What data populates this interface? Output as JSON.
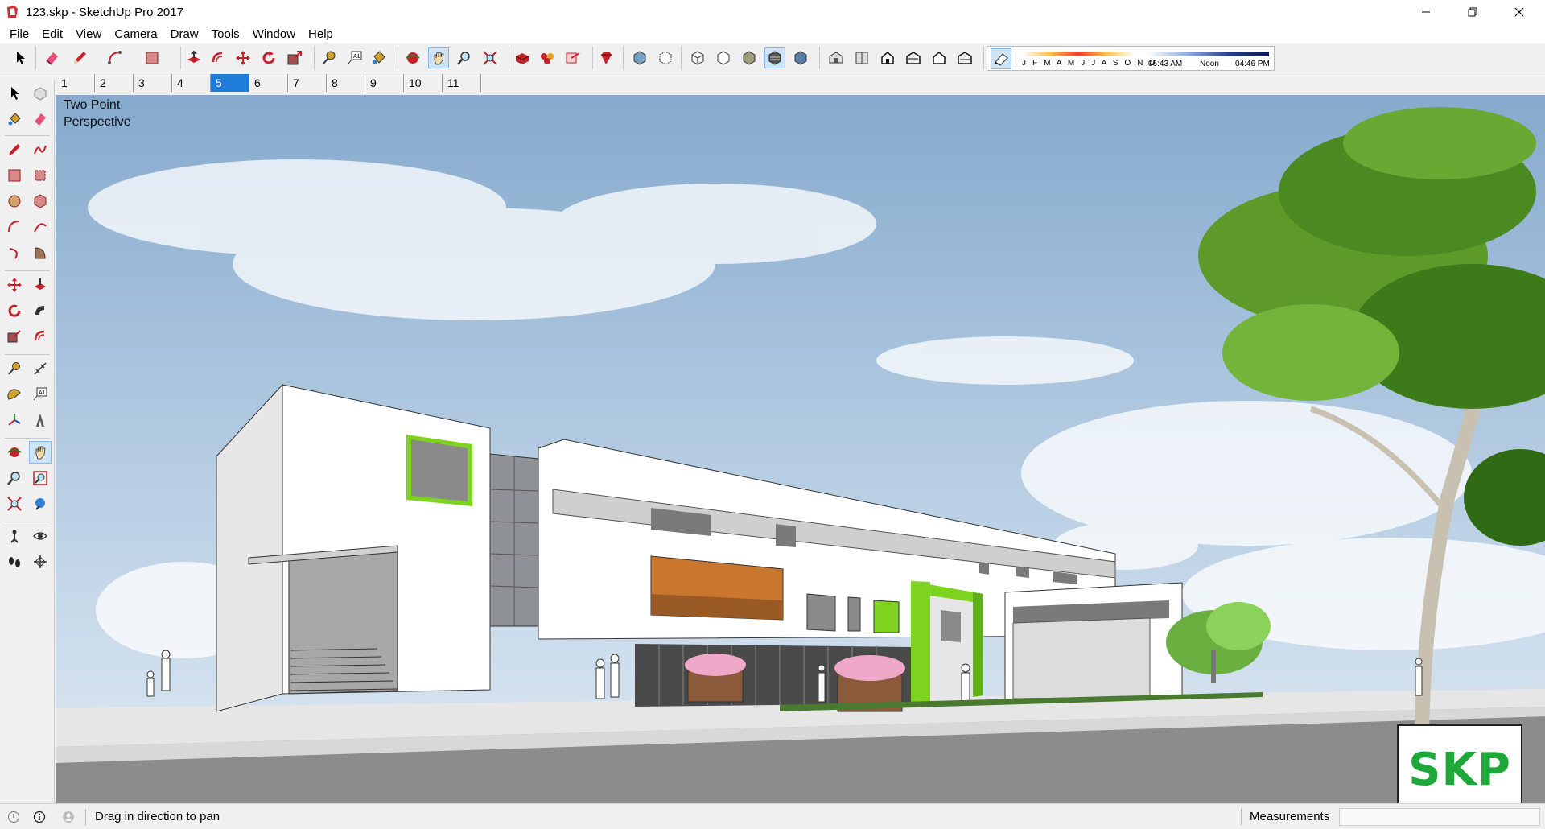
{
  "window": {
    "title": "123.skp - SketchUp Pro 2017",
    "app_icon": "sketchup-logo-icon",
    "controls": [
      "minimize-icon",
      "restore-icon",
      "close-icon"
    ]
  },
  "menu": [
    "File",
    "Edit",
    "View",
    "Camera",
    "Draw",
    "Tools",
    "Window",
    "Help"
  ],
  "toolbar": {
    "tools": [
      "select",
      "eraser",
      "line",
      "arc",
      "rectangle",
      "push-pull",
      "offset",
      "move",
      "rotate",
      "scale",
      "tape-measure",
      "text",
      "paint-bucket",
      "orbit",
      "pan",
      "zoom",
      "zoom-extents",
      "3d-warehouse",
      "extension-warehouse",
      "send-to-layout",
      "extension-manager",
      "x-ray",
      "back-edges",
      "wireframe",
      "hidden-line",
      "shaded",
      "shaded-with-textures",
      "monochrome",
      "iso-view",
      "top-view",
      "front-view",
      "right-view",
      "back-view",
      "left-view",
      "shadows"
    ],
    "active_tool": "pan"
  },
  "shadow_settings": {
    "months": "J F M A M J J A S O N D",
    "sunrise": "06:43 AM",
    "noon": "Noon",
    "sunset": "04:46 PM"
  },
  "scenes": {
    "tabs": [
      "1",
      "2",
      "3",
      "4",
      "5",
      "6",
      "7",
      "8",
      "9",
      "10",
      "11"
    ],
    "selected": "5"
  },
  "viewport": {
    "camera_label_line1": "Two Point",
    "camera_label_line2": "Perspective",
    "watermark": "SKP",
    "colors": {
      "sky": "#9ebcd9",
      "accent_green": "#7ed321",
      "window_orange": "#c9772e",
      "building": "#ffffff",
      "road": "#8c8c8c"
    }
  },
  "status": {
    "hint": "Drag in direction to pan",
    "measurements_label": "Measurements",
    "measurements_value": ""
  }
}
